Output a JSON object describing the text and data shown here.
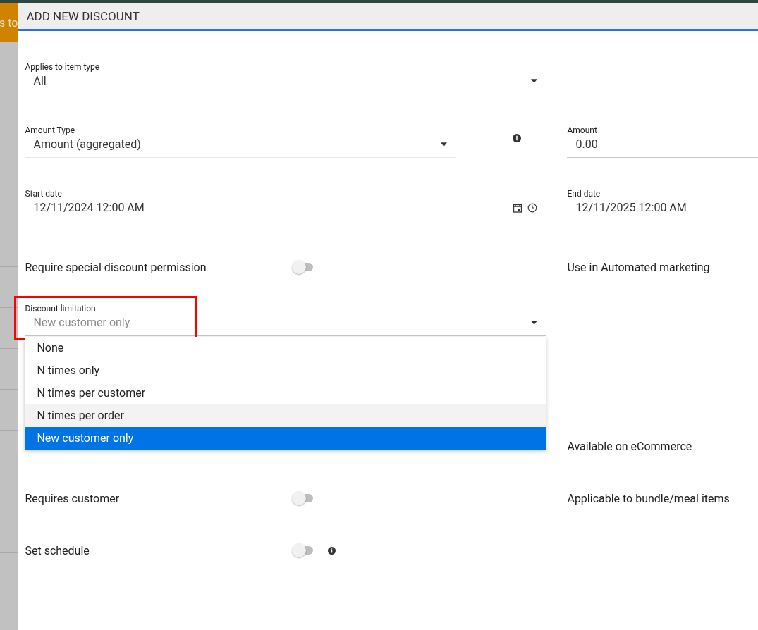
{
  "background": {
    "banner_text": "s to"
  },
  "dialog": {
    "title": "ADD NEW DISCOUNT"
  },
  "rows": [
    {
      "left": {
        "kind": "select",
        "label": "Applies to item type",
        "value": "All"
      }
    },
    {
      "left": {
        "kind": "select",
        "label": "Amount Type",
        "value": "Amount (aggregated)",
        "info": true
      },
      "right": {
        "kind": "input",
        "label": "Amount",
        "value": "0.00"
      }
    },
    {
      "left": {
        "kind": "datetime",
        "label": "Start date",
        "value": "12/11/2024 12:00 AM",
        "icons": true
      },
      "right": {
        "kind": "datetime",
        "label": "End date",
        "value": "12/11/2025 12:00 AM"
      }
    },
    {
      "left": {
        "kind": "toggle",
        "label": "Require special discount permission",
        "on": false
      },
      "right": {
        "kind": "text",
        "label": "Use in Automated marketing"
      }
    },
    {
      "left": {
        "kind": "select",
        "label": "Discount limitation",
        "value": "New customer only",
        "highlighted": true,
        "expanded": true,
        "options": [
          {
            "label": "None",
            "selected": false
          },
          {
            "label": "N times only",
            "selected": false
          },
          {
            "label": "N times per customer",
            "selected": false
          },
          {
            "label": "N times per order",
            "selected": false,
            "hovered": true
          },
          {
            "label": "New customer only",
            "selected": true
          }
        ]
      }
    },
    {
      "right": {
        "kind": "text",
        "label": "Available on eCommerce"
      }
    },
    {
      "left": {
        "kind": "toggle",
        "label": "Requires customer",
        "on": false
      },
      "right": {
        "kind": "text",
        "label": "Applicable to bundle/meal items"
      }
    },
    {
      "left": {
        "kind": "toggle",
        "label": "Set schedule",
        "on": false,
        "info": true
      }
    }
  ]
}
